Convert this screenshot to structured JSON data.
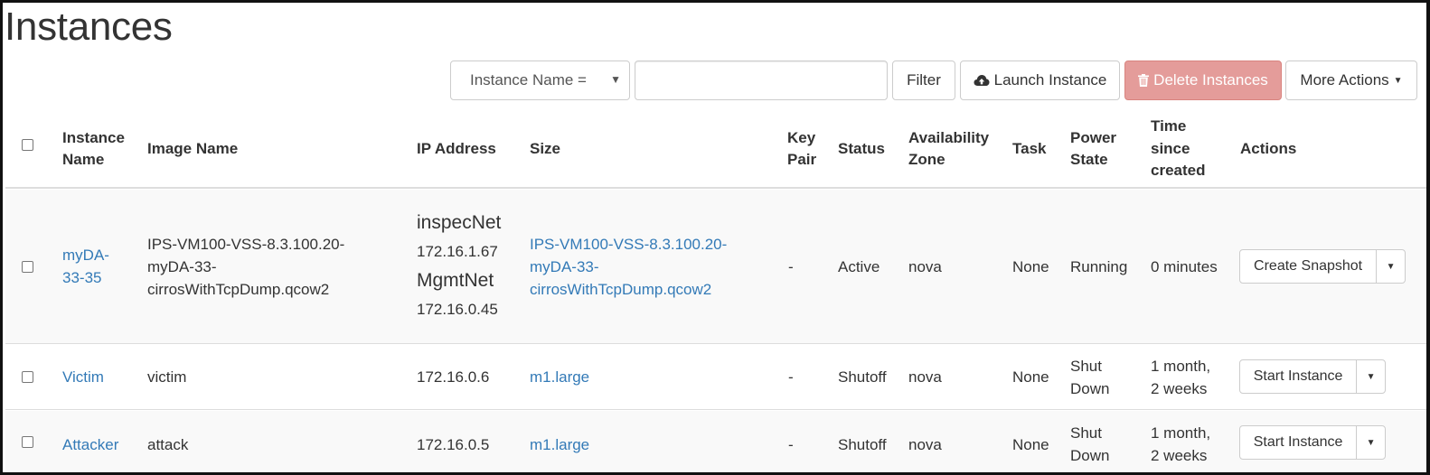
{
  "page": {
    "title": "Instances"
  },
  "toolbar": {
    "filter_select": "Instance Name =",
    "filter_input_value": "",
    "filter_button": "Filter",
    "launch_button": "Launch Instance",
    "delete_button": "Delete Instances",
    "more_actions_button": "More Actions"
  },
  "table": {
    "headers": {
      "instance_name": [
        "Instance",
        "Name"
      ],
      "image_name": "Image Name",
      "ip_address": "IP Address",
      "size": "Size",
      "key_pair": [
        "Key",
        "Pair"
      ],
      "status": "Status",
      "availability_zone": [
        "Availability",
        "Zone"
      ],
      "task": "Task",
      "power_state": [
        "Power",
        "State"
      ],
      "time_since_created": [
        "Time",
        "since",
        "created"
      ],
      "actions": "Actions"
    },
    "rows": [
      {
        "name": [
          "myDA-",
          "33-35"
        ],
        "image": [
          "IPS-VM100-VSS-8.3.100.20-",
          "myDA-33-",
          "cirrosWithTcpDump.qcow2"
        ],
        "ip": [
          {
            "net": "inspecNet",
            "addr": "172.16.1.67"
          },
          {
            "net": "MgmtNet",
            "addr": "172.16.0.45"
          }
        ],
        "size": [
          "IPS-VM100-VSS-8.3.100.20-",
          "myDA-33-",
          "cirrosWithTcpDump.qcow2"
        ],
        "key_pair": "-",
        "status": "Active",
        "zone": "nova",
        "task": "None",
        "power": [
          "Running"
        ],
        "time": [
          "0 minutes"
        ],
        "action": "Create Snapshot"
      },
      {
        "name": [
          "Victim"
        ],
        "image": [
          "victim"
        ],
        "ip": "172.16.0.6",
        "size": [
          "m1.large"
        ],
        "key_pair": "-",
        "status": "Shutoff",
        "zone": "nova",
        "task": "None",
        "power": [
          "Shut",
          "Down"
        ],
        "time": [
          "1 month,",
          "2 weeks"
        ],
        "action": "Start Instance"
      },
      {
        "name": [
          "Attacker"
        ],
        "image": [
          "attack"
        ],
        "ip": "172.16.0.5",
        "size": [
          "m1.large"
        ],
        "key_pair": "-",
        "status": "Shutoff",
        "zone": "nova",
        "task": "None",
        "power": [
          "Shut",
          "Down"
        ],
        "time": [
          "1 month,",
          "2 weeks"
        ],
        "action": "Start Instance"
      }
    ]
  },
  "icons": {
    "launch": "cloud-upload-icon",
    "delete": "trash-icon",
    "caret": "caret-down-icon"
  }
}
